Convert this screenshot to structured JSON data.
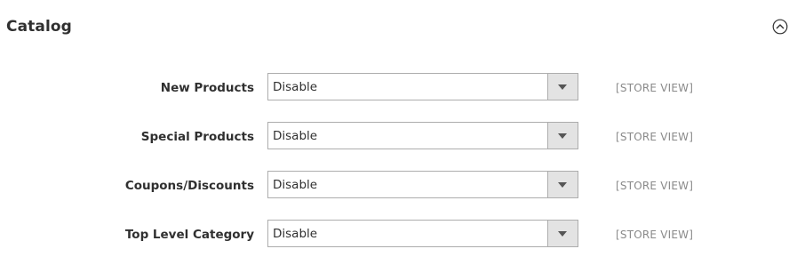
{
  "section": {
    "title": "Catalog",
    "toggle_icon": "chevron-up-circle-icon"
  },
  "fields": [
    {
      "label": "New Products",
      "value": "Disable",
      "scope": "[STORE VIEW]"
    },
    {
      "label": "Special Products",
      "value": "Disable",
      "scope": "[STORE VIEW]"
    },
    {
      "label": "Coupons/Discounts",
      "value": "Disable",
      "scope": "[STORE VIEW]"
    },
    {
      "label": "Top Level Category",
      "value": "Disable",
      "scope": "[STORE VIEW]"
    }
  ],
  "colors": {
    "text": "#303030",
    "scope": "#8a8a8a",
    "select_border": "#adadad",
    "select_arrow_bg": "#e3e3e3"
  }
}
